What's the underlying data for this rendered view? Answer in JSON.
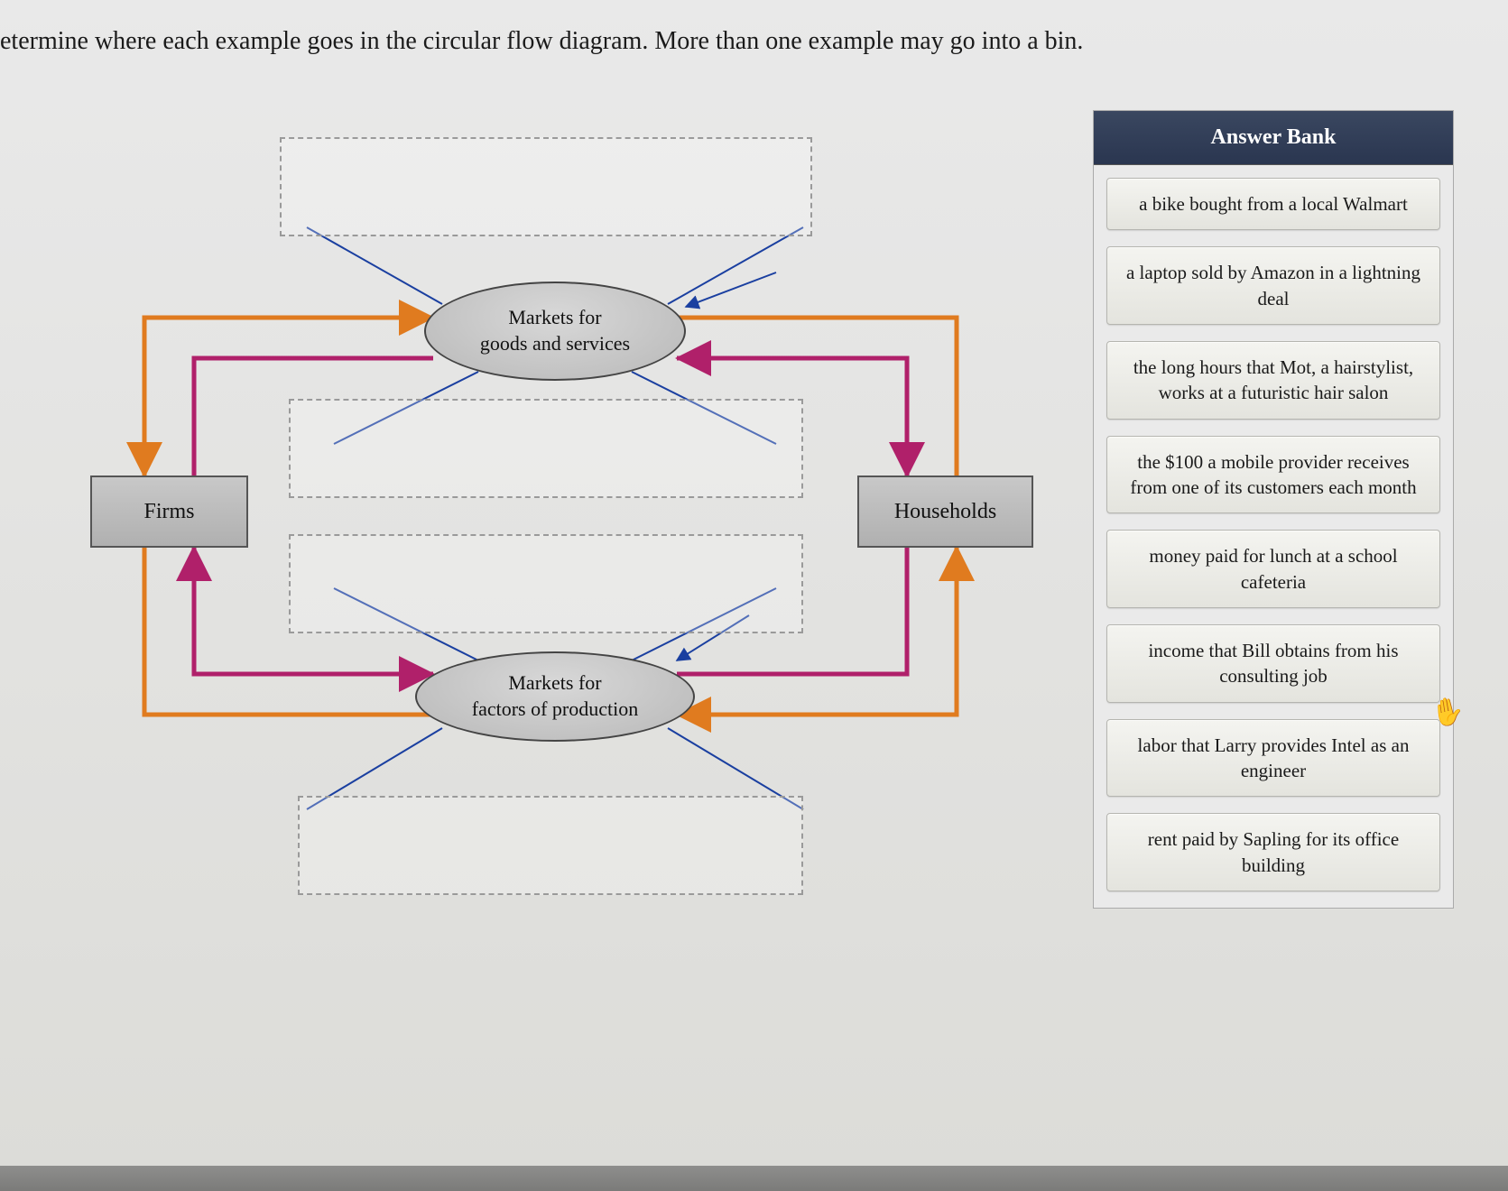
{
  "instructions": "etermine where each example goes in the circular flow diagram. More than one example may go into a bin.",
  "diagram": {
    "firms_label": "Firms",
    "households_label": "Households",
    "goods_market_line1": "Markets for",
    "goods_market_line2": "goods and services",
    "factors_market_line1": "Markets for",
    "factors_market_line2": "factors of production"
  },
  "answer_bank": {
    "header": "Answer Bank",
    "items": [
      "a bike bought from a local Walmart",
      "a laptop sold by Amazon in a lightning deal",
      "the long hours that Mot, a hairstylist, works at a futuristic hair salon",
      "the $100 a mobile provider receives from one of its customers each month",
      "money paid for lunch at a school cafeteria",
      "income that Bill obtains from his consulting job",
      "labor that Larry provides Intel as an engineer",
      "rent paid by Sapling for its office building"
    ]
  }
}
